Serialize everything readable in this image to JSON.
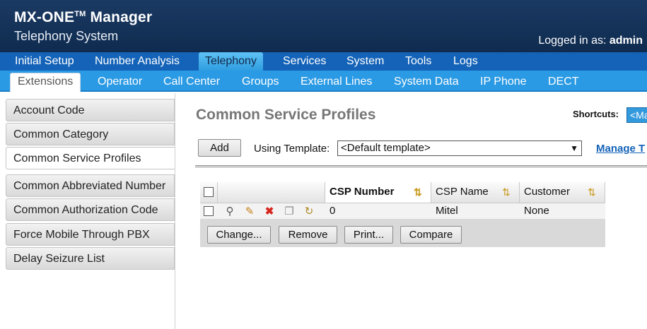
{
  "header": {
    "brand": "MX-ONE",
    "brand_tm": "TM",
    "brand_suffix": " Manager",
    "subtitle": "Telephony System",
    "logged_in_label": "Logged in as:",
    "user": "admin"
  },
  "main_nav": [
    "Initial Setup",
    "Number Analysis",
    "Telephony",
    "Services",
    "System",
    "Tools",
    "Logs"
  ],
  "sub_nav": [
    "Extensions",
    "Operator",
    "Call Center",
    "Groups",
    "External Lines",
    "System Data",
    "IP Phone",
    "DECT"
  ],
  "sidebar": [
    "Account Code",
    "Common Category",
    "Common Service Profiles",
    "Common Abbreviated Number",
    "Common Authorization Code",
    "Force Mobile Through PBX",
    "Delay Seizure List"
  ],
  "page": {
    "title": "Common Service Profiles",
    "shortcuts_label": "Shortcuts:",
    "shortcuts_value": "<Ma",
    "add_label": "Add",
    "template_label": "Using Template:",
    "template_value": "<Default template>",
    "manage_link": "Manage T"
  },
  "table": {
    "columns": [
      "CSP Number",
      "CSP Name",
      "Customer"
    ],
    "rows": [
      {
        "csp_number": "0",
        "csp_name": "Mitel",
        "customer": "None"
      }
    ],
    "actions": [
      "Change...",
      "Remove",
      "Print...",
      "Compare"
    ]
  },
  "colors": {
    "header_bg": "#0f2b4f",
    "main_nav_bg": "#1463b8",
    "sub_nav_bg": "#2b9ae4",
    "link": "#1463b8"
  }
}
